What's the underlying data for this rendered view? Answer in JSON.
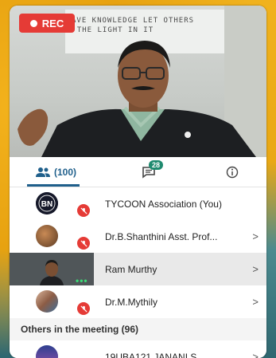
{
  "video": {
    "rec_label": "REC",
    "board_line1": "AVE KNOWLEDGE LET OTHERS",
    "board_line2": "T THE LIGHT IN IT"
  },
  "tabs": {
    "participants_label": "(100)",
    "chat_badge": "28"
  },
  "participants": [
    {
      "name": "TYCOON Association (You)",
      "muted": true,
      "chevron": false
    },
    {
      "name": "Dr.B.Shanthini Asst. Prof...",
      "muted": true,
      "chevron": true
    },
    {
      "name": "Ram Murthy",
      "muted": false,
      "chevron": true,
      "video": true
    },
    {
      "name": "Dr.M.Mythily",
      "muted": true,
      "chevron": true
    }
  ],
  "others_header": "Others in the meeting (96)",
  "others": [
    {
      "name": "19UBA121 JANANI S",
      "chevron": true
    }
  ],
  "chevron_glyph": ">",
  "colors": {
    "accent": "#1f5f8b",
    "rec": "#e53b36",
    "badge": "#1f8a6f"
  }
}
